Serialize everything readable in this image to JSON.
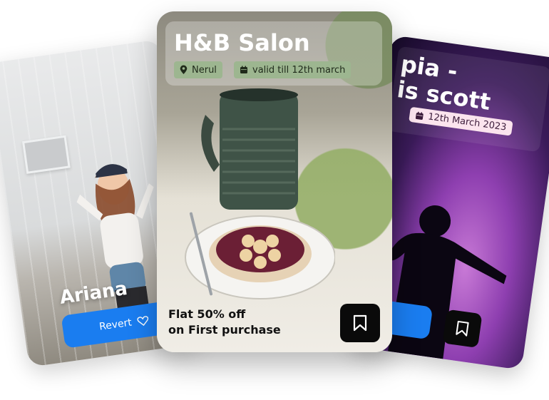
{
  "cards": {
    "left": {
      "name": "Ariana",
      "button_label": "Revert"
    },
    "right": {
      "title_line1": "pia -",
      "title_line2": "is scott",
      "date": "12th March 2023"
    },
    "center": {
      "title": "H&B Salon",
      "location": "Nerul",
      "validity": "valid till 12th march",
      "offer_line1": "Flat 50% off",
      "offer_line2": "on First purchase"
    }
  },
  "icons": {
    "location": "map-pin-icon",
    "calendar": "calendar-icon",
    "bookmark": "bookmark-icon",
    "heart": "heart-icon"
  },
  "colors": {
    "primary_button": "#1a7df0",
    "chip_green": "#9db690",
    "chip_pink": "#fbe4ee",
    "bookmark_bg": "#0a0a0a"
  }
}
